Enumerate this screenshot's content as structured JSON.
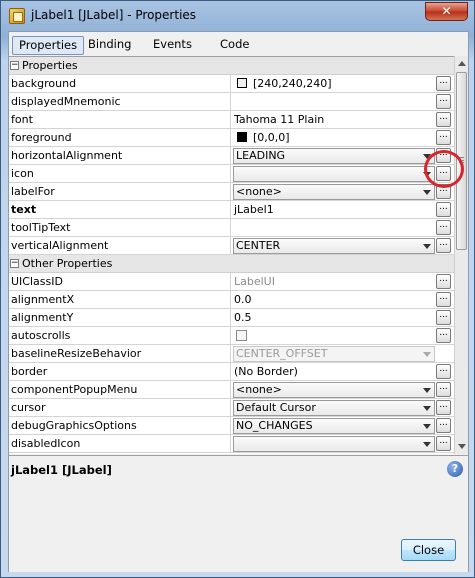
{
  "window": {
    "title": "jLabel1 [JLabel] - Properties",
    "close_label": "✕"
  },
  "tabs": [
    {
      "label": "Properties",
      "active": true
    },
    {
      "label": "Binding",
      "active": false
    },
    {
      "label": "Events",
      "active": false
    },
    {
      "label": "Code",
      "active": false
    }
  ],
  "categories": {
    "properties": "Properties",
    "other": "Other Properties",
    "toggle": "−"
  },
  "props": {
    "background": {
      "name": "background",
      "value": "[240,240,240]",
      "swatch": "#f0f0f0"
    },
    "displayedMnemonic": {
      "name": "displayedMnemonic",
      "value": ""
    },
    "font": {
      "name": "font",
      "value": "Tahoma 11 Plain"
    },
    "foreground": {
      "name": "foreground",
      "value": "[0,0,0]",
      "swatch": "#000000"
    },
    "horizontalAlignment": {
      "name": "horizontalAlignment",
      "value": "LEADING"
    },
    "icon": {
      "name": "icon",
      "value": ""
    },
    "labelFor": {
      "name": "labelFor",
      "value": "<none>"
    },
    "text": {
      "name": "text",
      "value": "jLabel1"
    },
    "toolTipText": {
      "name": "toolTipText",
      "value": ""
    },
    "verticalAlignment": {
      "name": "verticalAlignment",
      "value": "CENTER"
    }
  },
  "other": {
    "UIClassID": {
      "name": "UIClassID",
      "value": "LabelUI"
    },
    "alignmentX": {
      "name": "alignmentX",
      "value": "0.0"
    },
    "alignmentY": {
      "name": "alignmentY",
      "value": "0.5"
    },
    "autoscrolls": {
      "name": "autoscrolls",
      "checked": false
    },
    "baselineResizeBehavior": {
      "name": "baselineResizeBehavior",
      "value": "CENTER_OFFSET"
    },
    "border": {
      "name": "border",
      "value": "(No Border)"
    },
    "componentPopupMenu": {
      "name": "componentPopupMenu",
      "value": "<none>"
    },
    "cursor": {
      "name": "cursor",
      "value": "Default Cursor"
    },
    "debugGraphicsOptions": {
      "name": "debugGraphicsOptions",
      "value": "NO_CHANGES"
    },
    "disabledIcon": {
      "name": "disabledIcon",
      "value": ""
    }
  },
  "ellipsis": "...",
  "description": {
    "title": "jLabel1 [JLabel]",
    "help": "?"
  },
  "footer": {
    "close_label": "Close"
  },
  "annotation_color": "#d8252d"
}
